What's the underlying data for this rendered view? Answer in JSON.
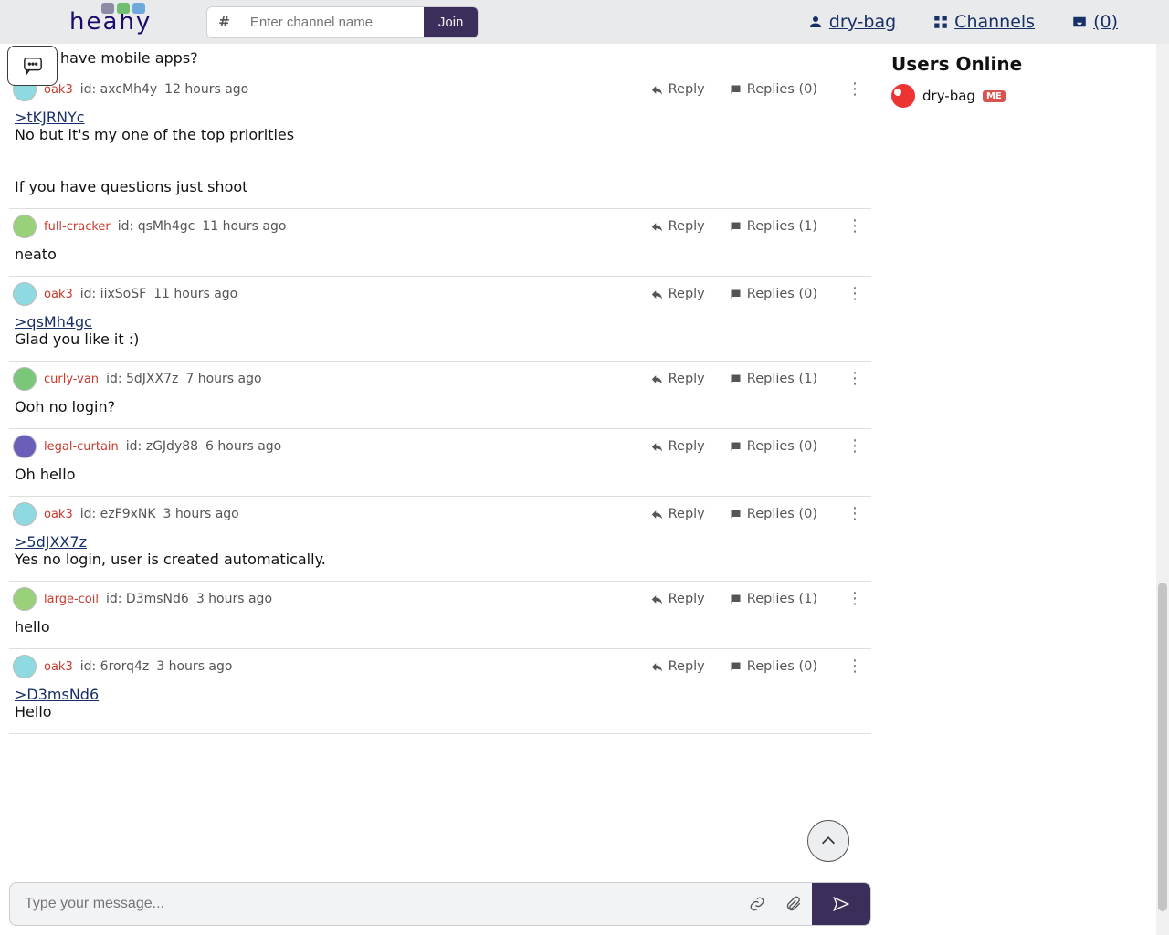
{
  "header": {
    "logo_text": "heahy",
    "hash": "#",
    "channel_placeholder": "Enter channel name",
    "join_label": "Join",
    "link_user": "dry-bag",
    "link_channels": "Channels",
    "link_inbox": "(0)"
  },
  "orphan_line": "have mobile apps?",
  "messages": [
    {
      "user": "oak3",
      "avatar_class": "",
      "id_label": "id: axcMh4y",
      "time": "12 hours ago",
      "reply_label": "Reply",
      "replies_label": "Replies (0)",
      "quote": ">tKJRNYc",
      "body": "No but it's my one of the top priorities\n\n\nIf you have questions just shoot"
    },
    {
      "user": "full-cracker",
      "avatar_class": "fc",
      "id_label": "id: qsMh4gc",
      "time": "11 hours ago",
      "reply_label": "Reply",
      "replies_label": "Replies (1)",
      "quote": "",
      "body": "neato"
    },
    {
      "user": "oak3",
      "avatar_class": "",
      "id_label": "id: iixSoSF",
      "time": "11 hours ago",
      "reply_label": "Reply",
      "replies_label": "Replies (0)",
      "quote": ">qsMh4gc",
      "body": "Glad you like it :)"
    },
    {
      "user": "curly-van",
      "avatar_class": "cv",
      "id_label": "id: 5dJXX7z",
      "time": "7 hours ago",
      "reply_label": "Reply",
      "replies_label": "Replies (1)",
      "quote": "",
      "body": "Ooh no login?"
    },
    {
      "user": "legal-curtain",
      "avatar_class": "lc",
      "id_label": "id: zGJdy88",
      "time": "6 hours ago",
      "reply_label": "Reply",
      "replies_label": "Replies (0)",
      "quote": "",
      "body": "Oh hello"
    },
    {
      "user": "oak3",
      "avatar_class": "",
      "id_label": "id: ezF9xNK",
      "time": "3 hours ago",
      "reply_label": "Reply",
      "replies_label": "Replies (0)",
      "quote": ">5dJXX7z",
      "body": "Yes no login, user is created automatically."
    },
    {
      "user": "large-coil",
      "avatar_class": "lco",
      "id_label": "id: D3msNd6",
      "time": "3 hours ago",
      "reply_label": "Reply",
      "replies_label": "Replies (1)",
      "quote": "",
      "body": "hello"
    },
    {
      "user": "oak3",
      "avatar_class": "",
      "id_label": "id: 6rorq4z",
      "time": "3 hours ago",
      "reply_label": "Reply",
      "replies_label": "Replies (0)",
      "quote": ">D3msNd6",
      "body": "Hello"
    }
  ],
  "sidebar": {
    "title": "Users Online",
    "user": "dry-bag",
    "me_badge": "ME"
  },
  "composer": {
    "placeholder": "Type your message..."
  }
}
